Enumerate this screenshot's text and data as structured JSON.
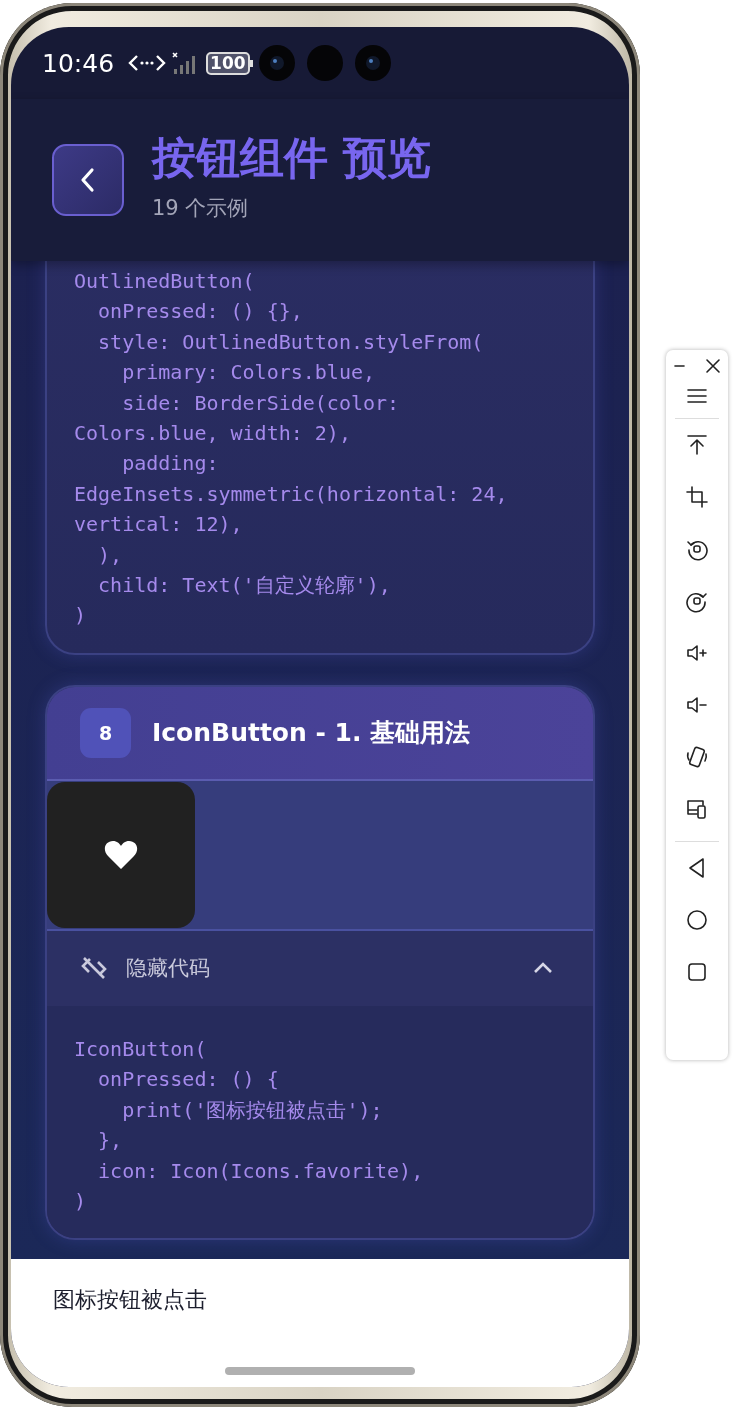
{
  "status_bar": {
    "time": "10:46",
    "battery": "100"
  },
  "header": {
    "title": "按钮组件 预览",
    "subtitle": "19 个示例"
  },
  "cards": [
    {
      "kind": "code_only",
      "code_lines": [
        "OutlinedButton(",
        "  onPressed: () {},",
        "  style: OutlinedButton.styleFrom(",
        "    primary: Colors.blue,",
        "    side: BorderSide(color:",
        "Colors.blue, width: 2),",
        "    padding:",
        "EdgeInsets.symmetric(horizontal: 24,",
        "vertical: 12),",
        "  ),",
        "  child: Text('自定义轮廓'),",
        ")"
      ]
    },
    {
      "kind": "full",
      "number": "8",
      "title": "IconButton - 1. 基础用法",
      "code_toggle": {
        "label": "隐藏代码",
        "expanded": true
      },
      "code_lines": [
        "IconButton(",
        "  onPressed: () {",
        "    print('图标按钮被点击');",
        "  },",
        "  icon: Icon(Icons.favorite),",
        ")"
      ]
    }
  ],
  "snackbar": {
    "message": "图标按钮被点击"
  }
}
